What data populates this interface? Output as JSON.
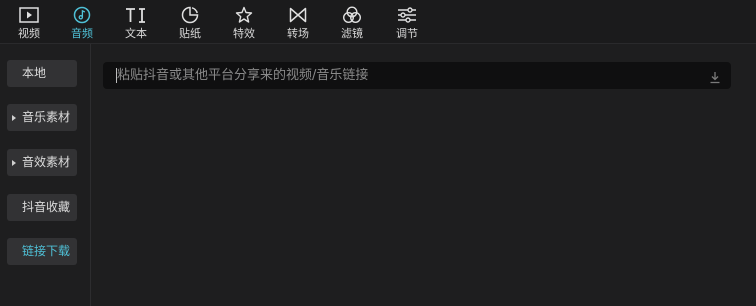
{
  "toolbar": {
    "tabs": [
      {
        "label": "视频",
        "icon": "video-icon"
      },
      {
        "label": "音频",
        "icon": "audio-icon"
      },
      {
        "label": "文本",
        "icon": "text-icon"
      },
      {
        "label": "贴纸",
        "icon": "sticker-icon"
      },
      {
        "label": "特效",
        "icon": "effects-icon"
      },
      {
        "label": "转场",
        "icon": "transition-icon"
      },
      {
        "label": "滤镜",
        "icon": "filter-icon"
      },
      {
        "label": "调节",
        "icon": "adjust-icon"
      }
    ],
    "active_tab": "音频"
  },
  "sidebar": {
    "items": [
      {
        "label": "本地",
        "has_caret": false
      },
      {
        "label": "音乐素材",
        "has_caret": true
      },
      {
        "label": "音效素材",
        "has_caret": true
      },
      {
        "label": "抖音收藏",
        "has_caret": false
      },
      {
        "label": "链接下载",
        "has_caret": false
      }
    ],
    "active_item": "链接下载"
  },
  "main": {
    "link_input": {
      "placeholder": "粘贴抖音或其他平台分享来的视频/音乐链接",
      "value": "",
      "action_icon": "download-icon"
    }
  },
  "colors": {
    "accent": "#4fc0d6",
    "background": "#1e1e1f",
    "button": "#323234",
    "input": "#0f0f10"
  }
}
